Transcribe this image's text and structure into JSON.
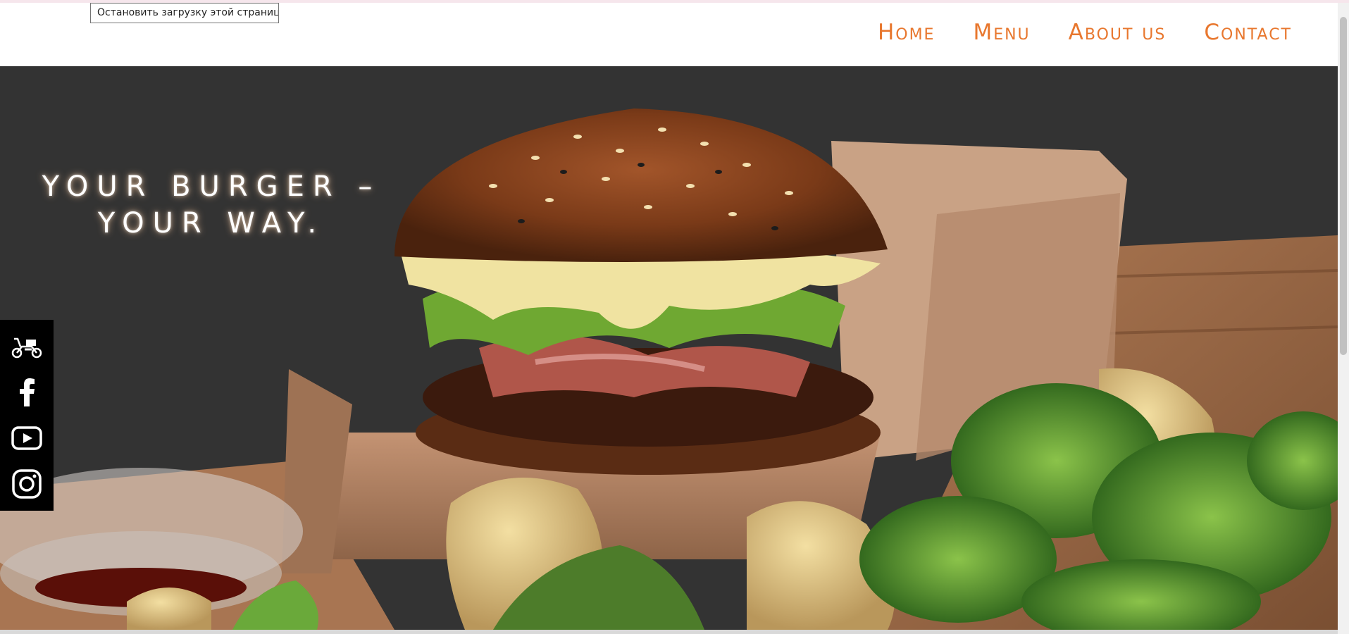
{
  "tooltip": {
    "text": "Остановить загрузку этой страницы"
  },
  "nav": {
    "items": [
      "Home",
      "Menu",
      "About us",
      "Contact"
    ]
  },
  "hero": {
    "tagline_line1": "YOUR BURGER –",
    "tagline_line2": "YOUR WAY."
  },
  "social": {
    "icons": [
      "scooter-delivery-icon",
      "facebook-icon",
      "youtube-icon",
      "instagram-icon"
    ]
  },
  "colors": {
    "accent": "#e8772e",
    "hero_bg": "#333333",
    "social_bg": "#000000"
  }
}
